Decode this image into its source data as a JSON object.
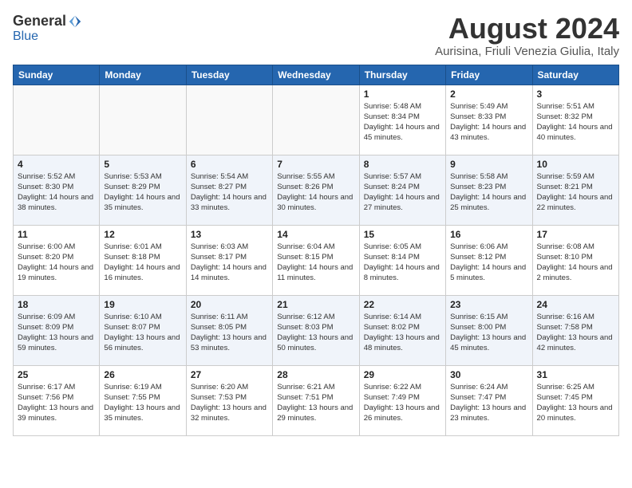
{
  "header": {
    "logo_general": "General",
    "logo_blue": "Blue",
    "month_title": "August 2024",
    "subtitle": "Aurisina, Friuli Venezia Giulia, Italy"
  },
  "days_of_week": [
    "Sunday",
    "Monday",
    "Tuesday",
    "Wednesday",
    "Thursday",
    "Friday",
    "Saturday"
  ],
  "weeks": [
    [
      {
        "day": "",
        "empty": true
      },
      {
        "day": "",
        "empty": true
      },
      {
        "day": "",
        "empty": true
      },
      {
        "day": "",
        "empty": true
      },
      {
        "day": "1",
        "sunrise": "5:48 AM",
        "sunset": "8:34 PM",
        "daylight": "14 hours and 45 minutes."
      },
      {
        "day": "2",
        "sunrise": "5:49 AM",
        "sunset": "8:33 PM",
        "daylight": "14 hours and 43 minutes."
      },
      {
        "day": "3",
        "sunrise": "5:51 AM",
        "sunset": "8:32 PM",
        "daylight": "14 hours and 40 minutes."
      }
    ],
    [
      {
        "day": "4",
        "sunrise": "5:52 AM",
        "sunset": "8:30 PM",
        "daylight": "14 hours and 38 minutes."
      },
      {
        "day": "5",
        "sunrise": "5:53 AM",
        "sunset": "8:29 PM",
        "daylight": "14 hours and 35 minutes."
      },
      {
        "day": "6",
        "sunrise": "5:54 AM",
        "sunset": "8:27 PM",
        "daylight": "14 hours and 33 minutes."
      },
      {
        "day": "7",
        "sunrise": "5:55 AM",
        "sunset": "8:26 PM",
        "daylight": "14 hours and 30 minutes."
      },
      {
        "day": "8",
        "sunrise": "5:57 AM",
        "sunset": "8:24 PM",
        "daylight": "14 hours and 27 minutes."
      },
      {
        "day": "9",
        "sunrise": "5:58 AM",
        "sunset": "8:23 PM",
        "daylight": "14 hours and 25 minutes."
      },
      {
        "day": "10",
        "sunrise": "5:59 AM",
        "sunset": "8:21 PM",
        "daylight": "14 hours and 22 minutes."
      }
    ],
    [
      {
        "day": "11",
        "sunrise": "6:00 AM",
        "sunset": "8:20 PM",
        "daylight": "14 hours and 19 minutes."
      },
      {
        "day": "12",
        "sunrise": "6:01 AM",
        "sunset": "8:18 PM",
        "daylight": "14 hours and 16 minutes."
      },
      {
        "day": "13",
        "sunrise": "6:03 AM",
        "sunset": "8:17 PM",
        "daylight": "14 hours and 14 minutes."
      },
      {
        "day": "14",
        "sunrise": "6:04 AM",
        "sunset": "8:15 PM",
        "daylight": "14 hours and 11 minutes."
      },
      {
        "day": "15",
        "sunrise": "6:05 AM",
        "sunset": "8:14 PM",
        "daylight": "14 hours and 8 minutes."
      },
      {
        "day": "16",
        "sunrise": "6:06 AM",
        "sunset": "8:12 PM",
        "daylight": "14 hours and 5 minutes."
      },
      {
        "day": "17",
        "sunrise": "6:08 AM",
        "sunset": "8:10 PM",
        "daylight": "14 hours and 2 minutes."
      }
    ],
    [
      {
        "day": "18",
        "sunrise": "6:09 AM",
        "sunset": "8:09 PM",
        "daylight": "13 hours and 59 minutes."
      },
      {
        "day": "19",
        "sunrise": "6:10 AM",
        "sunset": "8:07 PM",
        "daylight": "13 hours and 56 minutes."
      },
      {
        "day": "20",
        "sunrise": "6:11 AM",
        "sunset": "8:05 PM",
        "daylight": "13 hours and 53 minutes."
      },
      {
        "day": "21",
        "sunrise": "6:12 AM",
        "sunset": "8:03 PM",
        "daylight": "13 hours and 50 minutes."
      },
      {
        "day": "22",
        "sunrise": "6:14 AM",
        "sunset": "8:02 PM",
        "daylight": "13 hours and 48 minutes."
      },
      {
        "day": "23",
        "sunrise": "6:15 AM",
        "sunset": "8:00 PM",
        "daylight": "13 hours and 45 minutes."
      },
      {
        "day": "24",
        "sunrise": "6:16 AM",
        "sunset": "7:58 PM",
        "daylight": "13 hours and 42 minutes."
      }
    ],
    [
      {
        "day": "25",
        "sunrise": "6:17 AM",
        "sunset": "7:56 PM",
        "daylight": "13 hours and 39 minutes."
      },
      {
        "day": "26",
        "sunrise": "6:19 AM",
        "sunset": "7:55 PM",
        "daylight": "13 hours and 35 minutes."
      },
      {
        "day": "27",
        "sunrise": "6:20 AM",
        "sunset": "7:53 PM",
        "daylight": "13 hours and 32 minutes."
      },
      {
        "day": "28",
        "sunrise": "6:21 AM",
        "sunset": "7:51 PM",
        "daylight": "13 hours and 29 minutes."
      },
      {
        "day": "29",
        "sunrise": "6:22 AM",
        "sunset": "7:49 PM",
        "daylight": "13 hours and 26 minutes."
      },
      {
        "day": "30",
        "sunrise": "6:24 AM",
        "sunset": "7:47 PM",
        "daylight": "13 hours and 23 minutes."
      },
      {
        "day": "31",
        "sunrise": "6:25 AM",
        "sunset": "7:45 PM",
        "daylight": "13 hours and 20 minutes."
      }
    ]
  ]
}
